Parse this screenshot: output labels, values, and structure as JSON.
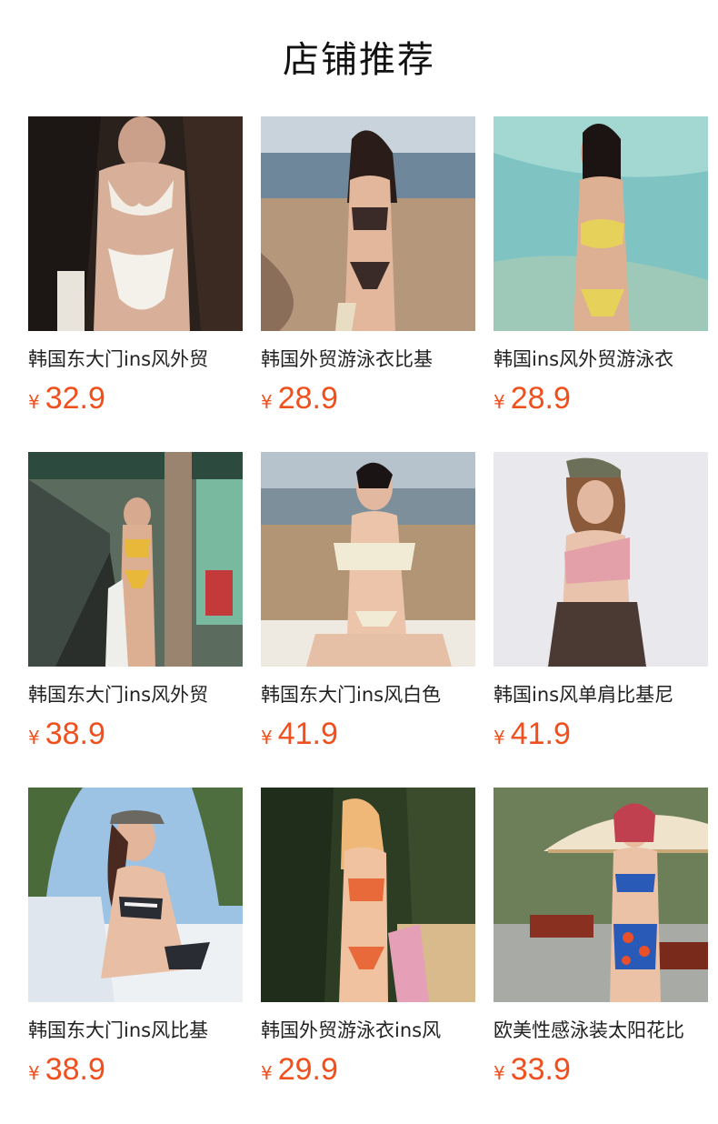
{
  "section": {
    "title": "店铺推荐"
  },
  "currency_symbol": "¥",
  "products": [
    {
      "name": "韩国东大门ins风外贸",
      "price": "32.9",
      "image": "white-bikini-rock-photo"
    },
    {
      "name": "韩国外贸游泳衣比基",
      "price": "28.9",
      "image": "black-print-bikini-beach-photo"
    },
    {
      "name": "韩国ins风外贸游泳衣",
      "price": "28.9",
      "image": "yellow-bandeau-bikini-sea-photo"
    },
    {
      "name": "韩国东大门ins风外贸",
      "price": "38.9",
      "image": "yellow-floral-bikini-terrace-photo"
    },
    {
      "name": "韩国东大门ins风白色",
      "price": "41.9",
      "image": "cream-offshoulder-bikini-sand-photo"
    },
    {
      "name": "韩国ins风单肩比基尼",
      "price": "41.9",
      "image": "pink-one-shoulder-skirt-swimsuit-photo"
    },
    {
      "name": "韩国东大门ins风比基",
      "price": "38.9",
      "image": "striped-bandeau-bikini-pool-photo"
    },
    {
      "name": "韩国外贸游泳衣ins风",
      "price": "29.9",
      "image": "orange-print-bikini-garden-photo"
    },
    {
      "name": "欧美性感泳装太阳花比",
      "price": "33.9",
      "image": "blue-sunflower-highwaist-bikini-photo"
    }
  ]
}
